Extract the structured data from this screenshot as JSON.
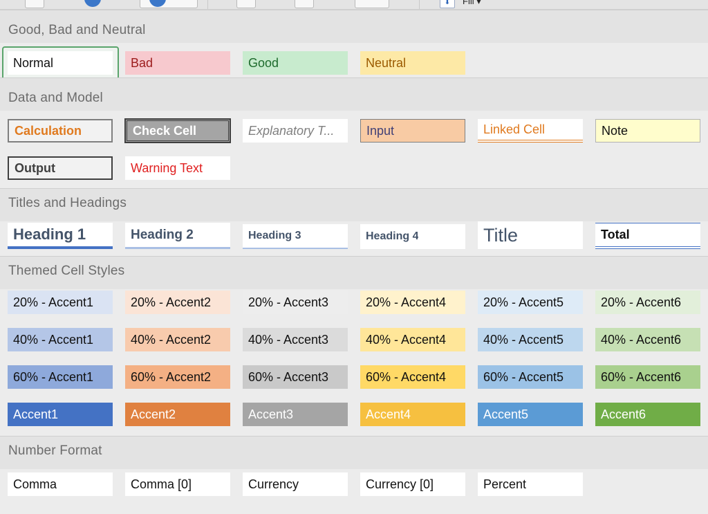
{
  "toolbar": {
    "fill_label": "Fill ▾"
  },
  "sections": {
    "good_bad_neutral": {
      "title": "Good, Bad and Neutral",
      "cells": [
        {
          "label": "Normal",
          "bg": "#ffffff",
          "fg": "#111111"
        },
        {
          "label": "Bad",
          "bg": "#f7c9ce",
          "fg": "#9c1c1c"
        },
        {
          "label": "Good",
          "bg": "#c8ebce",
          "fg": "#1e6b2d"
        },
        {
          "label": "Neutral",
          "bg": "#fde9a6",
          "fg": "#9b5a00"
        }
      ]
    },
    "data_model": {
      "title": "Data and Model",
      "cells": [
        {
          "label": "Calculation",
          "bg": "#f2f2f2",
          "fg": "#e07a1f"
        },
        {
          "label": "Check Cell",
          "bg": "#a5a5a5",
          "fg": "#ffffff"
        },
        {
          "label": "Explanatory T...",
          "bg": "#ffffff",
          "fg": "#7f7f7f"
        },
        {
          "label": "Input",
          "bg": "#f8cba4",
          "fg": "#3f3f76"
        },
        {
          "label": "Linked Cell",
          "bg": "#ffffff",
          "fg": "#e07a1f"
        },
        {
          "label": "Note",
          "bg": "#fffdcc",
          "fg": "#111111"
        },
        {
          "label": "Output",
          "bg": "#f2f2f2",
          "fg": "#3f3f3f"
        },
        {
          "label": "Warning Text",
          "bg": "#ffffff",
          "fg": "#e02020"
        }
      ]
    },
    "titles_headings": {
      "title": "Titles and Headings",
      "cells": [
        {
          "label": "Heading 1",
          "fg": "#44546a"
        },
        {
          "label": "Heading 2",
          "fg": "#44546a"
        },
        {
          "label": "Heading 3",
          "fg": "#44546a"
        },
        {
          "label": "Heading 4",
          "fg": "#44546a"
        },
        {
          "label": "Title",
          "fg": "#44546a"
        },
        {
          "label": "Total",
          "fg": "#111111"
        }
      ]
    },
    "themed": {
      "title": "Themed Cell Styles",
      "rows": [
        [
          {
            "label": "20% - Accent1",
            "bg": "#dae3f3",
            "fg": "#111111"
          },
          {
            "label": "20% - Accent2",
            "bg": "#fbe4d6",
            "fg": "#111111"
          },
          {
            "label": "20% - Accent3",
            "bg": "#ededed",
            "fg": "#111111"
          },
          {
            "label": "20% - Accent4",
            "bg": "#fff2cc",
            "fg": "#111111"
          },
          {
            "label": "20% - Accent5",
            "bg": "#deebf7",
            "fg": "#111111"
          },
          {
            "label": "20% - Accent6",
            "bg": "#e2efda",
            "fg": "#111111"
          }
        ],
        [
          {
            "label": "40% - Accent1",
            "bg": "#b4c6e7",
            "fg": "#111111"
          },
          {
            "label": "40% - Accent2",
            "bg": "#f8cbad",
            "fg": "#111111"
          },
          {
            "label": "40% - Accent3",
            "bg": "#dbdbdb",
            "fg": "#111111"
          },
          {
            "label": "40% - Accent4",
            "bg": "#ffe699",
            "fg": "#111111"
          },
          {
            "label": "40% - Accent5",
            "bg": "#bdd7ee",
            "fg": "#111111"
          },
          {
            "label": "40% - Accent6",
            "bg": "#c6e0b4",
            "fg": "#111111"
          }
        ],
        [
          {
            "label": "60% - Accent1",
            "bg": "#8ea9db",
            "fg": "#111111"
          },
          {
            "label": "60% - Accent2",
            "bg": "#f4b084",
            "fg": "#111111"
          },
          {
            "label": "60% - Accent3",
            "bg": "#c9c9c9",
            "fg": "#111111"
          },
          {
            "label": "60% - Accent4",
            "bg": "#ffd966",
            "fg": "#111111"
          },
          {
            "label": "60% - Accent5",
            "bg": "#9bc2e6",
            "fg": "#111111"
          },
          {
            "label": "60% - Accent6",
            "bg": "#a9d08e",
            "fg": "#111111"
          }
        ],
        [
          {
            "label": "Accent1",
            "bg": "#4472c4",
            "fg": "#ffffff"
          },
          {
            "label": "Accent2",
            "bg": "#e08140",
            "fg": "#ffffff"
          },
          {
            "label": "Accent3",
            "bg": "#a5a5a5",
            "fg": "#ffffff"
          },
          {
            "label": "Accent4",
            "bg": "#f6c040",
            "fg": "#ffffff"
          },
          {
            "label": "Accent5",
            "bg": "#5b9bd5",
            "fg": "#ffffff"
          },
          {
            "label": "Accent6",
            "bg": "#70ad47",
            "fg": "#ffffff"
          }
        ]
      ]
    },
    "number_format": {
      "title": "Number Format",
      "cells": [
        {
          "label": "Comma"
        },
        {
          "label": "Comma [0]"
        },
        {
          "label": "Currency"
        },
        {
          "label": "Currency [0]"
        },
        {
          "label": "Percent"
        }
      ]
    }
  }
}
